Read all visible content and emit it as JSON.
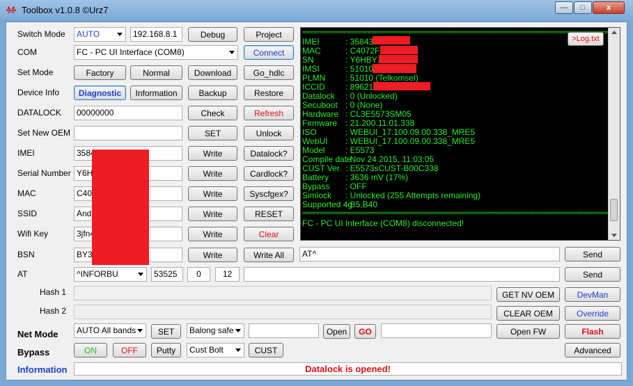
{
  "window": {
    "title": "Toolbox v1.0.8 ©Urz7",
    "min_glyph": "—",
    "max_glyph": "□",
    "close_glyph": "x"
  },
  "rows": {
    "switch_mode": {
      "label": "Switch Mode",
      "select": "AUTO",
      "ip": "192.168.8.1",
      "btn1": "Debug",
      "btn2": "Project"
    },
    "com": {
      "label": "COM",
      "select": "FC - PC UI Interface (COM8)",
      "btn": "Connect"
    },
    "set_mode": {
      "label": "Set Mode",
      "btn1": "Factory",
      "btn2": "Normal",
      "btn3": "Download",
      "btn4": "Go_hdlc"
    },
    "device_info": {
      "label": "Device Info",
      "btn1": "Diagnostic",
      "btn2": "Information",
      "btn3": "Backup",
      "btn4": "Restore"
    },
    "datalock": {
      "label": "DATALOCK",
      "value": "00000000",
      "btn1": "Check",
      "btn2": "Refresh"
    },
    "set_new_oem": {
      "label": "Set New OEM",
      "value": "",
      "btn1": "SET",
      "btn2": "Unlock"
    },
    "imei": {
      "label": "IMEI",
      "value": "3584",
      "btn1": "Write",
      "btn2": "Datalock?"
    },
    "serial": {
      "label": "Serial Number",
      "value": "Y6H",
      "btn1": "Write",
      "btn2": "Cardlock?"
    },
    "mac": {
      "label": "MAC",
      "value": "C407",
      "btn1": "Write",
      "btn2": "Syscfgex?"
    },
    "ssid": {
      "label": "SSID",
      "value": "Andr",
      "btn1": "Write",
      "btn2": "RESET"
    },
    "wifi_key": {
      "label": "Wifi Key",
      "value": "3jfn4",
      "btn1": "Write",
      "btn2": "Clear"
    },
    "bsn": {
      "label": "BSN",
      "value": "BY3",
      "btn1": "Write",
      "btn2": "Write All",
      "at_cmd": "AT^",
      "send": "Send"
    },
    "at": {
      "label": "AT",
      "select": "^INFORBU",
      "v1": "53525",
      "v2": "0",
      "v3": "12",
      "cmd": "",
      "send": "Send"
    },
    "hash1": {
      "label": "Hash 1",
      "value": "",
      "btn1": "GET NV OEM",
      "btn2": "DevMan"
    },
    "hash2": {
      "label": "Hash 2",
      "value": "",
      "btn1": "CLEAR OEM",
      "btn2": "Override"
    },
    "net_mode": {
      "label": "Net Mode",
      "select": "AUTO  All bands",
      "set": "SET",
      "select2": "Balong safe",
      "field": "",
      "open": "Open",
      "go": "GO",
      "field2": "",
      "open_fw": "Open FW",
      "flash": "Flash"
    },
    "bypass": {
      "label": "Bypass",
      "on": "ON",
      "off": "OFF",
      "putty": "Putty",
      "select": "Cust Bolt",
      "cust": "CUST",
      "advanced": "Advanced"
    },
    "information": {
      "label": "Information",
      "status": "Datalock is opened!"
    }
  },
  "console": {
    "log_button": ">Log.txt",
    "separator": "============================================================================================================",
    "lines": [
      {
        "k": "IMEI",
        "v": ": 358433"
      },
      {
        "k": "MAC",
        "v": ": C4072F6"
      },
      {
        "k": "SN",
        "v": ": Y6HBY15"
      },
      {
        "k": "IMSI",
        "v": ": 510100"
      },
      {
        "k": "PLMN",
        "v": ": 51010 (Telkomsel)"
      },
      {
        "k": "ICCID",
        "v": ": 896210"
      },
      {
        "k": "Datalock",
        "v": ": 0 (Unlocked)"
      },
      {
        "k": "Secuboot",
        "v": ": 0 (None)"
      },
      {
        "k": "Hardware",
        "v": ": CL3E5573SM05"
      },
      {
        "k": "Firmware",
        "v": ": 21.200.11.01.338"
      },
      {
        "k": "ISO",
        "v": ": WEBUI_17.100.09.00.338_MRE5"
      },
      {
        "k": "WebUI",
        "v": ": WEBUI_17.100.09.00.338_MRE5"
      },
      {
        "k": "Model",
        "v": ": E5573"
      },
      {
        "k": "Compile date",
        "v": ": Nov 24 2015, 11:03:05"
      },
      {
        "k": "CUST Ver.",
        "v": ": E5573sCUST-B00C338"
      },
      {
        "k": "Battery",
        "v": ": 3636 mV (17%)"
      },
      {
        "k": "Bypass",
        "v": ": OFF"
      },
      {
        "k": "Simlock",
        "v": ": Unlocked (255 Attempts remaining)"
      },
      {
        "k": "Supported 4g",
        "v": ": B5,B40"
      }
    ],
    "disconnect": "FC - PC UI Interface (COM8) disconnected!"
  },
  "colors": {
    "redaction": "#ee1c24",
    "console_text": "#22ee22"
  }
}
